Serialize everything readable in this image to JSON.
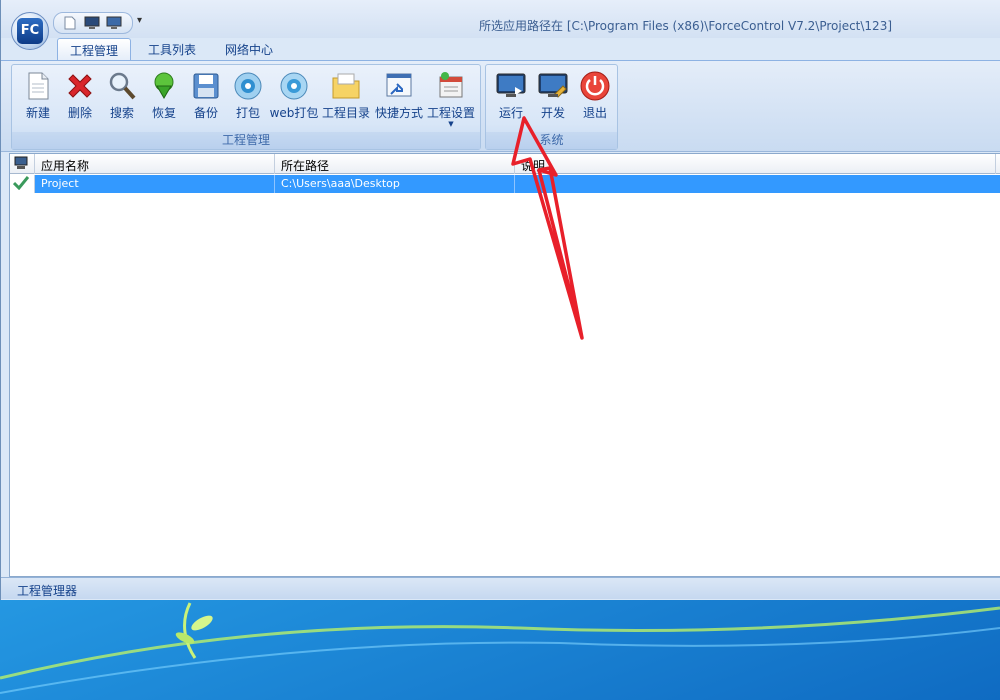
{
  "window": {
    "title": "所选应用路径在 [C:\\Program Files (x86)\\ForceControl V7.2\\Project\\123]",
    "logo_text": "FC"
  },
  "tabs": [
    {
      "label": "工程管理",
      "active": true
    },
    {
      "label": "工具列表",
      "active": false
    },
    {
      "label": "网络中心",
      "active": false
    }
  ],
  "ribbon": {
    "project_group": {
      "label": "工程管理",
      "buttons": [
        {
          "label": "新建",
          "icon": "new-document-icon"
        },
        {
          "label": "删除",
          "icon": "delete-icon"
        },
        {
          "label": "搜索",
          "icon": "search-icon"
        },
        {
          "label": "恢复",
          "icon": "restore-icon"
        },
        {
          "label": "备份",
          "icon": "backup-icon"
        },
        {
          "label": "打包",
          "icon": "pack-disc-icon"
        },
        {
          "label": "web打包",
          "icon": "web-pack-disc-icon"
        },
        {
          "label": "工程目录",
          "icon": "folder-icon"
        },
        {
          "label": "快捷方式",
          "icon": "shortcut-icon"
        },
        {
          "label": "工程设置",
          "icon": "settings-icon"
        }
      ]
    },
    "system_group": {
      "label": "系统",
      "buttons": [
        {
          "label": "运行",
          "icon": "run-monitor-icon"
        },
        {
          "label": "开发",
          "icon": "develop-monitor-icon"
        },
        {
          "label": "退出",
          "icon": "power-icon"
        }
      ]
    }
  },
  "list": {
    "columns": [
      "应用名称",
      "所在路径",
      "说明"
    ],
    "rows": [
      {
        "name": "Project",
        "path": "C:\\Users\\aaa\\Desktop",
        "description": "",
        "checked": true,
        "selected": true
      }
    ]
  },
  "status": {
    "text": "工程管理器"
  },
  "colors": {
    "selection": "#3399ff",
    "annotation_arrow": "#e8202a",
    "ribbon_text": "#15428b"
  }
}
